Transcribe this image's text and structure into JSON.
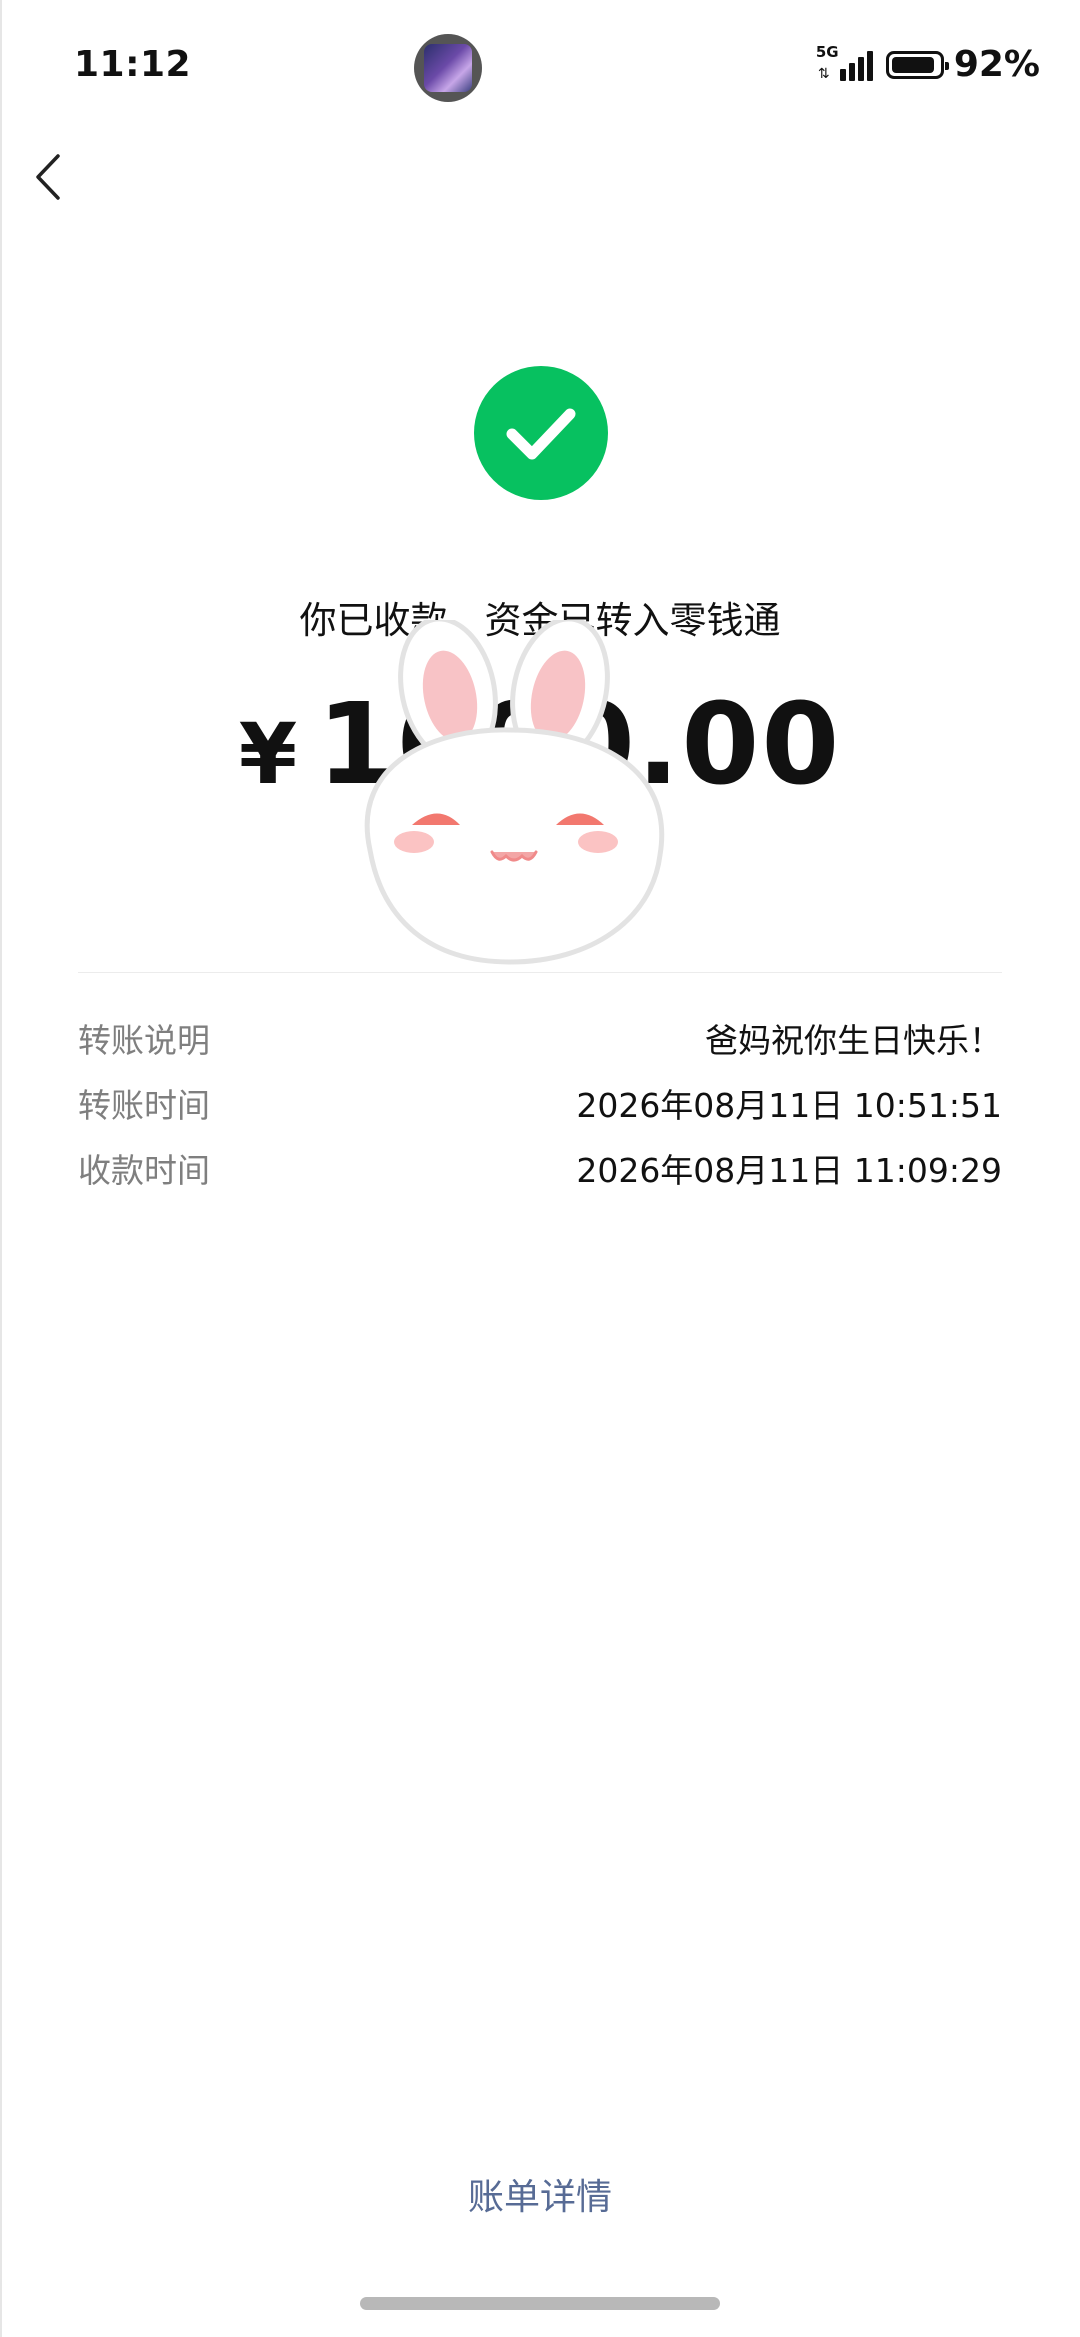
{
  "status_bar": {
    "time": "11:12",
    "network": "5G",
    "battery_percent": "92%",
    "battery_level": 0.92
  },
  "nav": {
    "back_icon": "chevron-left-icon"
  },
  "result": {
    "icon": "check-circle-icon",
    "icon_color": "#07c160",
    "title": "你已收款，资金已转入零钱通",
    "currency_symbol": "¥",
    "amount": "1000.00"
  },
  "details": {
    "rows": [
      {
        "label": "转账说明",
        "value": "爸妈祝你生日快乐！"
      },
      {
        "label": "转账时间",
        "value": "2026年08月11日 10:51:51"
      },
      {
        "label": "收款时间",
        "value": "2026年08月11日 11:09:29"
      }
    ]
  },
  "footer": {
    "bill_link": "账单详情",
    "link_color": "#576b95"
  },
  "overlay": {
    "sticker": "bunny-sticker"
  }
}
